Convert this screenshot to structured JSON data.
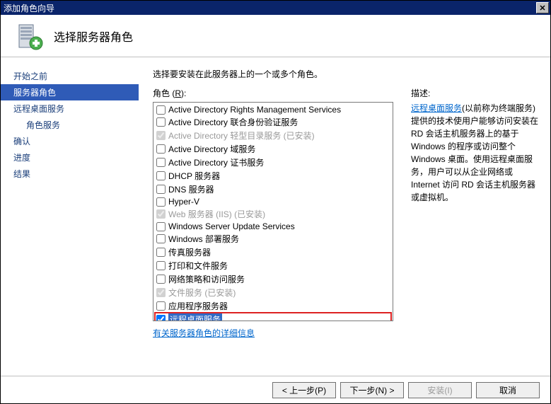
{
  "window": {
    "title": "添加角色向导"
  },
  "header": {
    "title": "选择服务器角色"
  },
  "sidebar": {
    "items": [
      {
        "label": "开始之前",
        "active": false,
        "indent": false
      },
      {
        "label": "服务器角色",
        "active": true,
        "indent": false
      },
      {
        "label": "远程桌面服务",
        "active": false,
        "indent": false
      },
      {
        "label": "角色服务",
        "active": false,
        "indent": true
      },
      {
        "label": "确认",
        "active": false,
        "indent": false
      },
      {
        "label": "进度",
        "active": false,
        "indent": false
      },
      {
        "label": "结果",
        "active": false,
        "indent": false
      }
    ]
  },
  "main": {
    "instruction": "选择要安装在此服务器上的一个或多个角色。",
    "roles_label_prefix": "角色 (",
    "roles_label_key": "R",
    "roles_label_suffix": "):",
    "roles": [
      {
        "label": "Active Directory Rights Management Services",
        "checked": false,
        "disabled": false
      },
      {
        "label": "Active Directory 联合身份验证服务",
        "checked": false,
        "disabled": false
      },
      {
        "label": "Active Directory 轻型目录服务  (已安装)",
        "checked": true,
        "disabled": true
      },
      {
        "label": "Active Directory 域服务",
        "checked": false,
        "disabled": false
      },
      {
        "label": "Active Directory 证书服务",
        "checked": false,
        "disabled": false
      },
      {
        "label": "DHCP 服务器",
        "checked": false,
        "disabled": false
      },
      {
        "label": "DNS 服务器",
        "checked": false,
        "disabled": false
      },
      {
        "label": "Hyper-V",
        "checked": false,
        "disabled": false
      },
      {
        "label": "Web 服务器 (IIS)  (已安装)",
        "checked": true,
        "disabled": true
      },
      {
        "label": "Windows Server Update Services",
        "checked": false,
        "disabled": false
      },
      {
        "label": "Windows 部署服务",
        "checked": false,
        "disabled": false
      },
      {
        "label": "传真服务器",
        "checked": false,
        "disabled": false
      },
      {
        "label": "打印和文件服务",
        "checked": false,
        "disabled": false
      },
      {
        "label": "网络策略和访问服务",
        "checked": false,
        "disabled": false
      },
      {
        "label": "文件服务  (已安装)",
        "checked": true,
        "disabled": true
      },
      {
        "label": "应用程序服务器",
        "checked": false,
        "disabled": false
      },
      {
        "label": "远程桌面服务",
        "checked": true,
        "disabled": false,
        "selected": true,
        "highlight": true
      }
    ],
    "desc_title": "描述:",
    "desc_link": "远程桌面服务",
    "desc_text": "(以前称为终端服务)提供的技术使用户能够访问安装在 RD 会话主机服务器上的基于 Windows 的程序或访问整个 Windows 桌面。使用远程桌面服务，用户可以从企业网络或 Internet 访问 RD 会话主机服务器或虚拟机。",
    "more_link": "有关服务器角色的详细信息"
  },
  "footer": {
    "prev": "< 上一步(P)",
    "next": "下一步(N) >",
    "install": "安装(I)",
    "cancel": "取消"
  }
}
